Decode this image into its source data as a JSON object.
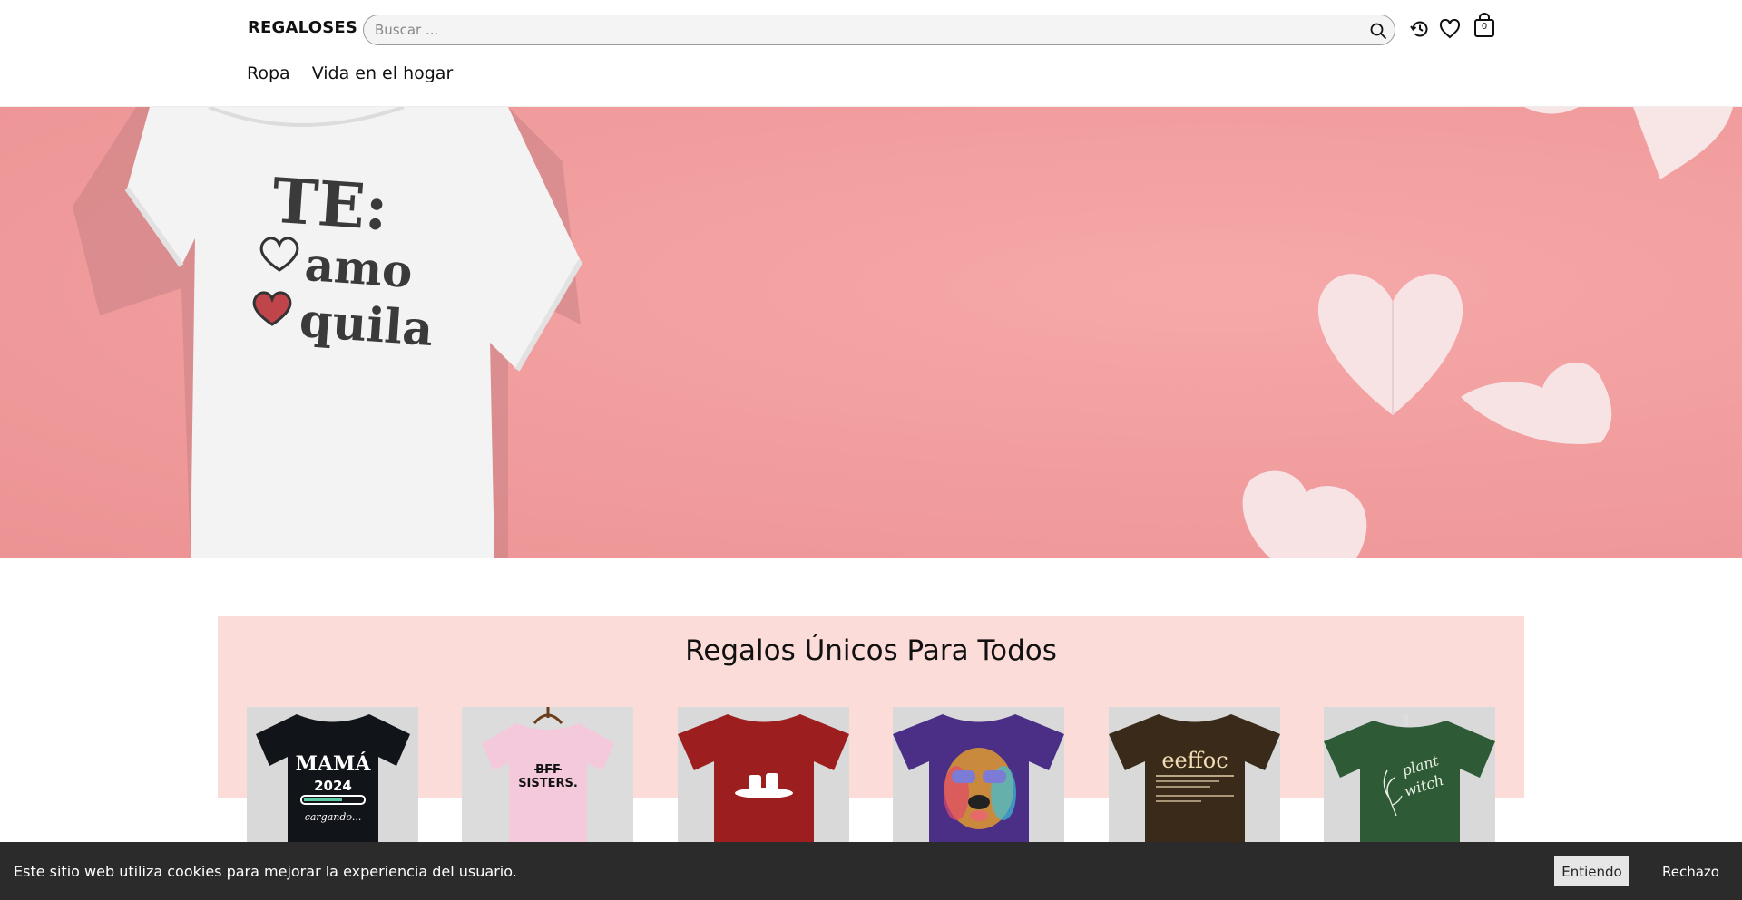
{
  "header": {
    "logo": "REGALOSES",
    "search": {
      "placeholder": "Buscar ..."
    },
    "icons": [
      "search-icon",
      "history-icon",
      "heart-icon",
      "shopping-bag-icon"
    ],
    "cart_count": "0"
  },
  "nav": {
    "items": [
      {
        "label": "Ropa"
      },
      {
        "label": "Vida en el hogar"
      }
    ]
  },
  "hero": {
    "tshirt_text_line1": "TE:",
    "tshirt_text_line2": "amo",
    "tshirt_text_line3": "quila",
    "background_color": "#f19d9e"
  },
  "section": {
    "title": "Regalos Únicos Para Todos",
    "background_color": "#fcdcd9"
  },
  "products": [
    {
      "shirt_color": "#111418",
      "print_text": "MAMÁ 2024 cargando..."
    },
    {
      "shirt_color": "#f5c9dc",
      "print_text": "BFF SISTERS."
    },
    {
      "shirt_color": "#9c1e1e",
      "print_text": ""
    },
    {
      "shirt_color": "#4b2f86",
      "print_text": ""
    },
    {
      "shirt_color": "#3a2a1a",
      "print_text": "eeffoc"
    },
    {
      "shirt_color": "#2f5a36",
      "print_text": "plant witch"
    }
  ],
  "cookie_bar": {
    "message": "Este sitio web utiliza cookies para mejorar la experiencia del usuario.",
    "accept_label": "Entiendo",
    "reject_label": "Rechazo"
  }
}
